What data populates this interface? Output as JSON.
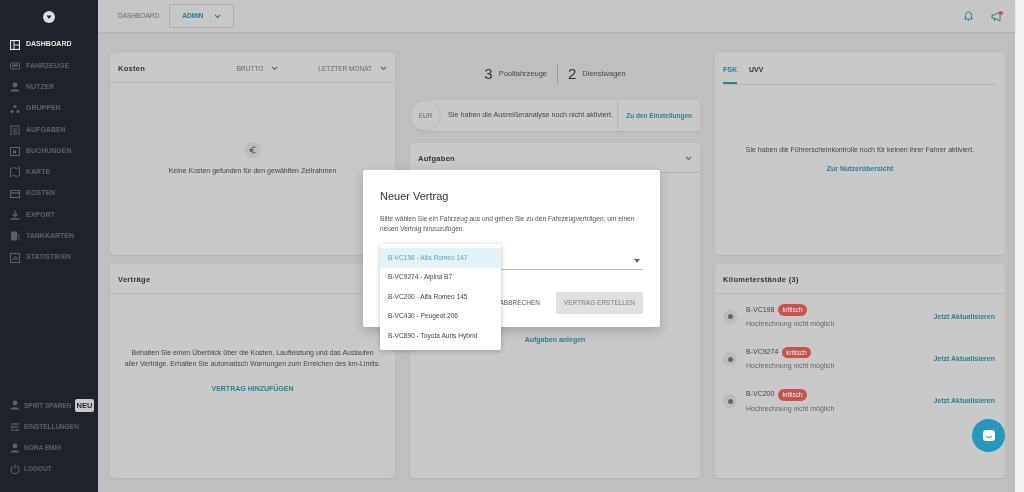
{
  "sidebar": {
    "items": [
      {
        "label": "DASHBOARD",
        "selected": true
      },
      {
        "label": "FAHRZEUGE",
        "selected": false
      },
      {
        "label": "NUTZER",
        "selected": false
      },
      {
        "label": "GRUPPEN",
        "selected": false
      },
      {
        "label": "AUFGABEN",
        "selected": false
      },
      {
        "label": "BUCHUNGEN",
        "selected": false
      },
      {
        "label": "KARTE",
        "selected": false
      },
      {
        "label": "KOSTEN",
        "selected": false
      },
      {
        "label": "EXPORT",
        "selected": false
      },
      {
        "label": "TANKKARTEN",
        "selected": false
      },
      {
        "label": "STATISTIKEN",
        "selected": false
      }
    ],
    "bottom_items": [
      {
        "label": "SPRIT SPAREN",
        "badge": "NEU"
      },
      {
        "label": "EINSTELLUNGEN"
      },
      {
        "label": "NORA EMIG"
      },
      {
        "label": "LOGOUT"
      }
    ]
  },
  "header": {
    "breadcrumb": "DASHBOARD",
    "role": "ADMIN",
    "announcement_unread": true
  },
  "costs": {
    "title": "Kosten",
    "filters": [
      "BRUTTO",
      "LETZTER MONAT"
    ],
    "empty": "Keine Kosten gefunden für den gewählten Zeitrahmen"
  },
  "fleet": {
    "pool_count": "3",
    "pool_label": "Poolfahrzeuge",
    "company_count": "2",
    "company_label": "Dienstwagen"
  },
  "outlier": {
    "badge": "EUR",
    "text": "Sie haben die Ausreißeranalyse noch nicht aktiviert.",
    "link": "Zu den Einstellungen"
  },
  "tasks": {
    "title": "Aufgaben",
    "link": "Aufgaben anlegen"
  },
  "license": {
    "tabs": [
      {
        "label": "FSK",
        "selected": true
      },
      {
        "label": "UVV",
        "selected": false
      }
    ],
    "text": "Sie haben die Führerscheinkontrolle noch für keinen ihrer Fahrer aktiviert.",
    "link": "Zur Nutzerübersicht"
  },
  "contracts": {
    "title": "Verträge",
    "text": "Behalten Sie einen Überblick über die Kosten, Laufleistung und das Auslaufen aller Verträge. Erhalten Sie automatisch Warnungen zum Erreichen des km-Limits.",
    "link": "VERTRAG HINZUFÜGEN"
  },
  "mileage": {
    "title": "Kilometerstände (3)",
    "rows": [
      {
        "plate": "B-VC198",
        "tag": "kritisch",
        "note": "Hochrechnung nicht möglich",
        "action": "Jetzt Aktualisieren"
      },
      {
        "plate": "B-VC9274",
        "tag": "kritisch",
        "note": "Hochrechnung nicht möglich",
        "action": "Jetzt Aktualisieren"
      },
      {
        "plate": "B-VC200",
        "tag": "kritisch",
        "note": "Hochrechnung nicht möglich",
        "action": "Jetzt Aktualisieren"
      }
    ]
  },
  "modal": {
    "title": "Neuer Vertrag",
    "text": "Bitte wählen Sie ein Fahrzeug aus und gehen Sie zu den Fahrzeugverträgen, um einen neuen Vertrag hinzuzufügen.",
    "options": [
      {
        "label": "B-VC198 - Alfa Romeo 147",
        "selected": true
      },
      {
        "label": "B-VC9274 - Alpina B7",
        "selected": false
      },
      {
        "label": "B-VC200 - Alfa Romeo 145",
        "selected": false
      },
      {
        "label": "B-VC430 - Peugeot 206",
        "selected": false
      },
      {
        "label": "B-VC890 - Toyota Auris Hybrid",
        "selected": false
      }
    ],
    "cancel": "ABBRECHEN",
    "submit": {
      "label": "VERTRAG ERSTELLEN",
      "disabled": true
    }
  }
}
